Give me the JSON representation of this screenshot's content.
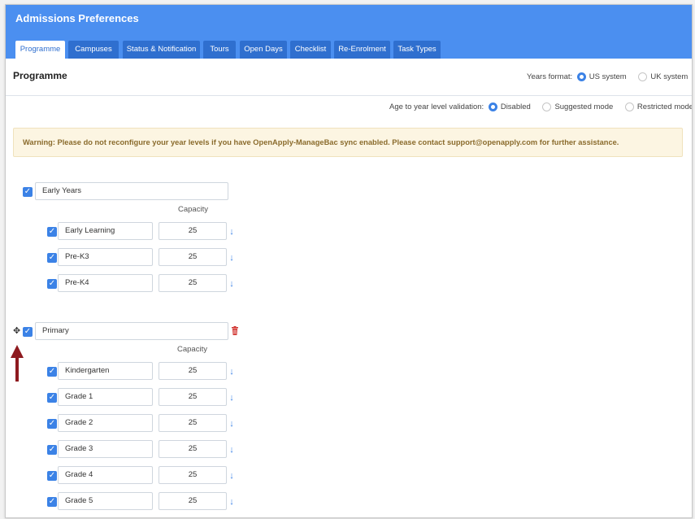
{
  "title": "Admissions Preferences",
  "tabs": [
    {
      "label": "Programme",
      "active": true
    },
    {
      "label": "Campuses",
      "active": false
    },
    {
      "label": "Status & Notification",
      "active": false
    },
    {
      "label": "Tours",
      "active": false
    },
    {
      "label": "Open Days",
      "active": false
    },
    {
      "label": "Checklist",
      "active": false
    },
    {
      "label": "Re-Enrolment",
      "active": false
    },
    {
      "label": "Task Types",
      "active": false
    }
  ],
  "section_title": "Programme",
  "years_format": {
    "label": "Years format:",
    "options": [
      {
        "label": "US system",
        "selected": true
      },
      {
        "label": "UK system",
        "selected": false
      }
    ]
  },
  "age_validation": {
    "label": "Age to year level validation:",
    "options": [
      {
        "label": "Disabled",
        "selected": true
      },
      {
        "label": "Suggested mode",
        "selected": false
      },
      {
        "label": "Restricted mode",
        "selected": false
      }
    ]
  },
  "warning": "Warning: Please do not reconfigure your year levels if you have OpenApply-ManageBac sync enabled. Please contact support@openapply.com for further assistance.",
  "capacity_label": "Capacity",
  "programmes": [
    {
      "name": "Early Years",
      "checked": true,
      "levels": [
        {
          "name": "Early Learning",
          "capacity": "25",
          "checked": true
        },
        {
          "name": "Pre-K3",
          "capacity": "25",
          "checked": true
        },
        {
          "name": "Pre-K4",
          "capacity": "25",
          "checked": true
        }
      ]
    },
    {
      "name": "Primary",
      "checked": true,
      "levels": [
        {
          "name": "Kindergarten",
          "capacity": "25",
          "checked": true
        },
        {
          "name": "Grade 1",
          "capacity": "25",
          "checked": true
        },
        {
          "name": "Grade 2",
          "capacity": "25",
          "checked": true
        },
        {
          "name": "Grade 3",
          "capacity": "25",
          "checked": true
        },
        {
          "name": "Grade 4",
          "capacity": "25",
          "checked": true
        },
        {
          "name": "Grade 5",
          "capacity": "25",
          "checked": true
        }
      ]
    }
  ],
  "colors": {
    "header": "#4b8ff0",
    "tab": "#2f6fcf",
    "accent": "#3b82e6",
    "warning_bg": "#fcf5e2",
    "warning_text": "#8a6b2c",
    "delete": "#d0302c",
    "annotation_arrow": "#8e1a1f"
  },
  "icons": {
    "checkbox": "checkbox-checked-icon",
    "down_arrow": "arrow-down-icon",
    "delete": "trash-icon",
    "move": "move-icon"
  }
}
